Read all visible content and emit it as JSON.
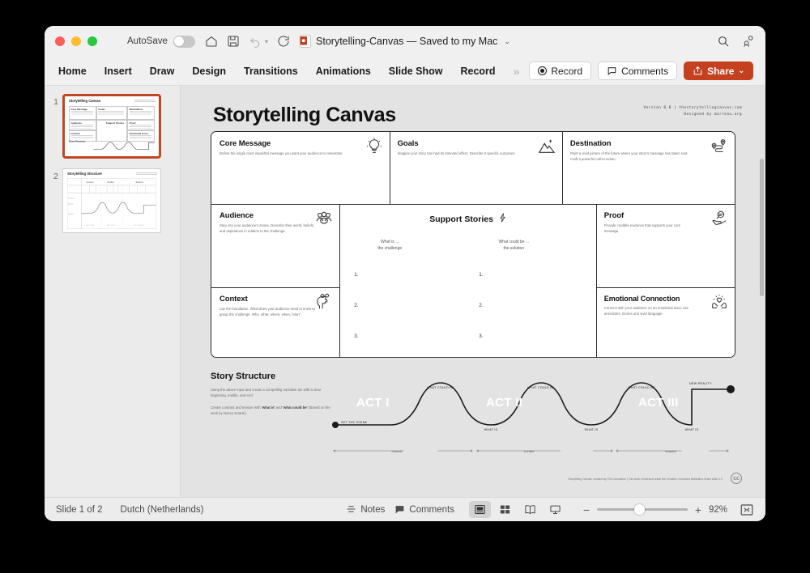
{
  "window": {
    "autosave_label": "AutoSave",
    "document_title": "Storytelling-Canvas — Saved to my Mac",
    "titlebar_icons": [
      "home-icon",
      "save-icon",
      "undo-icon",
      "redo-icon",
      "more-icon"
    ],
    "right_icons": [
      "search-icon",
      "collaborate-icon"
    ]
  },
  "ribbon": {
    "tabs": [
      {
        "label": "Home"
      },
      {
        "label": "Insert"
      },
      {
        "label": "Draw"
      },
      {
        "label": "Design"
      },
      {
        "label": "Transitions"
      },
      {
        "label": "Animations"
      },
      {
        "label": "Slide Show"
      },
      {
        "label": "Record"
      }
    ],
    "overflow": "»",
    "record_label": "Record",
    "comments_label": "Comments",
    "share_label": "Share",
    "share_color": "#c4401f"
  },
  "thumbnails": [
    {
      "number": "1",
      "title": "Storytelling Canvas",
      "selected": true
    },
    {
      "number": "2",
      "title": "Storytelling Structure",
      "selected": false
    }
  ],
  "slide": {
    "title": "Storytelling Canvas",
    "version_line1": "Version 0.8  |  thestorytellingcanvas.com",
    "version_line2": "Designed by morreau.org",
    "cells": [
      {
        "title": "Core Message",
        "desc": "Define the single most impactful message you want your audience to remember.",
        "icon": "lightbulb-icon"
      },
      {
        "title": "Goals",
        "desc": "Imagine your story has had its intended effect. Describe 3 specific outcomes.",
        "icon": "mountain-icon"
      },
      {
        "title": "Destination",
        "desc": "Paint a vivid picture of the future where your story's message has taken root. Craft a powerful call-to-action.",
        "icon": "route-pin-icon"
      },
      {
        "title": "Audience",
        "desc": "Step into your audience's shoes. Describe their world, beliefs, and aspirations in relation to the challenge.",
        "icon": "people-icon"
      },
      {
        "title": "Context",
        "desc": "Lay the foundation. What does your audience need to know to grasp the challenge. Who, what, where, when, how?",
        "icon": "head-gears-icon"
      },
      {
        "title": "Proof",
        "desc": "Provide credible evidence that supports your core message.",
        "icon": "hand-magnify-icon"
      },
      {
        "title": "Emotional Connection",
        "desc": "Connect with your audience on an emotional level, use anecdotes, stories and vivid language.",
        "icon": "hands-heart-icon"
      }
    ],
    "support_stories": {
      "title": "Support Stories",
      "icon": "bolt-icon",
      "col_left_line1": "What is ...",
      "col_left_line2": "the challenge",
      "col_right_line1": "What could be ...",
      "col_right_line2": "the solution",
      "items": [
        "1.",
        "2.",
        "3."
      ]
    },
    "story_structure": {
      "title": "Story Structure",
      "para1": "Using the above input and create a compelling narrative arc with a clear beginning, middle, and end.",
      "para2_pre": "Create contrast and tension with ",
      "para2_b1": "'what is'",
      "para2_mid": " and ",
      "para2_b2": "'what could be'",
      "para2_post": " (Based on the work by Nancy Duarte).",
      "acts": [
        "ACT I",
        "ACT II",
        "ACT III"
      ],
      "start_label": "SET THE SCENE",
      "end_label": "NEW REALITY",
      "peak_labels": [
        "WHAT COULD BE",
        "WHAT COULD BE",
        "WHAT COULD BE"
      ],
      "trough_labels": [
        "WHAT IS",
        "WHAT IS",
        "WHAT IS"
      ],
      "phases": [
        "Context",
        "Conflict",
        "Solution"
      ]
    },
    "footer": "Storytelling Canvas, created by ITSJ Innovation | This work is licensed under the Creative Commons Attribution-Share Alike 4.0",
    "cc_icon": "creative-commons-icon"
  },
  "statusbar": {
    "slide_count": "Slide 1 of 2",
    "language": "Dutch (Netherlands)",
    "notes_label": "Notes",
    "comments_label": "Comments",
    "zoom_out": "−",
    "zoom_in": "+",
    "zoom_level": "92%",
    "views": [
      "normal-view",
      "slide-sorter-view",
      "reading-view",
      "presenter-view"
    ]
  }
}
